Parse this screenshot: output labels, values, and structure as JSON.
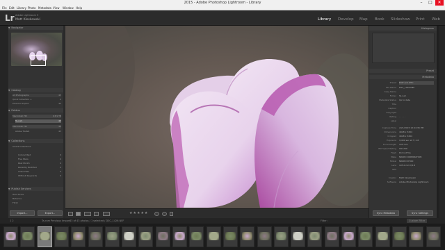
{
  "window": {
    "title": "2015 - Adobe Photoshop Lightroom - Library",
    "minimize": "–",
    "maximize": "□",
    "close": "✕"
  },
  "menu": [
    "File",
    "Edit",
    "Library",
    "Photo",
    "Metadata",
    "View",
    "Window",
    "Help"
  ],
  "identity": {
    "logo": "Lr",
    "catalog": "Adobe Lightroom 5",
    "user": "Matt Kloskowski"
  },
  "modules": [
    {
      "label": "Library",
      "active": true
    },
    {
      "label": "Develop",
      "active": false
    },
    {
      "label": "Map",
      "active": false
    },
    {
      "label": "Book",
      "active": false
    },
    {
      "label": "Slideshow",
      "active": false
    },
    {
      "label": "Print",
      "active": false
    },
    {
      "label": "Web",
      "active": false
    }
  ],
  "left": {
    "navigator": {
      "title": "Navigator",
      "zoom": "FIT  FILL  1:1  3:1"
    },
    "catalog": {
      "title": "Catalog",
      "items": [
        {
          "label": "All Photographs",
          "count": "43"
        },
        {
          "label": "Quick Collection +",
          "count": "0"
        },
        {
          "label": "Previous Import",
          "count": "43"
        }
      ]
    },
    "folders": {
      "title": "Folders",
      "items": [
        {
          "label": "Macintosh HD",
          "count": "63/1 TB"
        },
        {
          "label": "Ta-rum",
          "count": "43"
        },
        {
          "label": "Macintosh HD",
          "count": "46"
        },
        {
          "label": "Adobe TGIAIS",
          "count": "43"
        }
      ]
    },
    "collections": {
      "title": "Collections",
      "items": [
        {
          "label": "Smart Collections",
          "count": ""
        },
        {
          "label": "Colored Red",
          "count": "0"
        },
        {
          "label": "Five Stars",
          "count": "0"
        },
        {
          "label": "Past Month",
          "count": "0"
        },
        {
          "label": "Recently Modified",
          "count": "0"
        },
        {
          "label": "Video Files",
          "count": "0"
        },
        {
          "label": "Without Keywords",
          "count": "0"
        }
      ]
    },
    "publish": {
      "title": "Publish Services",
      "items": [
        {
          "label": "Hard Drive",
          "count": ""
        },
        {
          "label": "Behance",
          "count": ""
        },
        {
          "label": "Flickr",
          "count": ""
        }
      ]
    },
    "import_button": "Import...",
    "export_button": "Export..."
  },
  "right": {
    "histogram_title": "Histogram",
    "metadata_title": "Metadata",
    "preset": "Default",
    "preset_label": "Preset",
    "rows": [
      {
        "k": "Preset",
        "v": "EXIF and IPTC"
      },
      {
        "k": "File Name",
        "v": "DSC_1426.NEF"
      },
      {
        "k": "Copy Name",
        "v": ""
      },
      {
        "k": "Folder",
        "v": "Ta-rum"
      },
      {
        "k": "Metadata Status",
        "v": "Up to date"
      },
      {
        "k": "Title",
        "v": ""
      },
      {
        "k": "Caption",
        "v": ""
      },
      {
        "k": "Copyright",
        "v": ""
      },
      {
        "k": "Rating",
        "v": "· · · · ·"
      },
      {
        "k": "Label",
        "v": ""
      },
      {
        "k": "Capture Time",
        "v": "2/21/2015 12:44:36 PM"
      },
      {
        "k": "Dimensions",
        "v": "4928 x 3264"
      },
      {
        "k": "Cropped",
        "v": "4928 x 3264"
      },
      {
        "k": "Exposure",
        "v": "1/400 sec at f / 2.8"
      },
      {
        "k": "Focal Length",
        "v": "105 mm"
      },
      {
        "k": "ISO Speed Rating",
        "v": "ISO 200"
      },
      {
        "k": "Flash",
        "v": "Did not fire"
      },
      {
        "k": "Make",
        "v": "NIKON CORPORATION"
      },
      {
        "k": "Model",
        "v": "NIKON D7000"
      },
      {
        "k": "Lens",
        "v": "105.0 mm f/2.8"
      },
      {
        "k": "GPS",
        "v": ""
      },
      {
        "k": "Creator",
        "v": "Matt Kloskowski"
      },
      {
        "k": "Software",
        "v": "Adobe Photoshop Lightroom"
      }
    ],
    "sync_button": "Sync Metadata",
    "sync_settings_button": "Sync Settings"
  },
  "toolbar": {
    "stars": "★★★★★"
  },
  "filmbar": {
    "pages": "1  2",
    "source": "Ta-rum  Previous Import",
    "status": "43 of 43 photos / 1 selected / DSC_1426.NEF",
    "filter": "Filter :",
    "filter_value": "Custom Filter"
  }
}
